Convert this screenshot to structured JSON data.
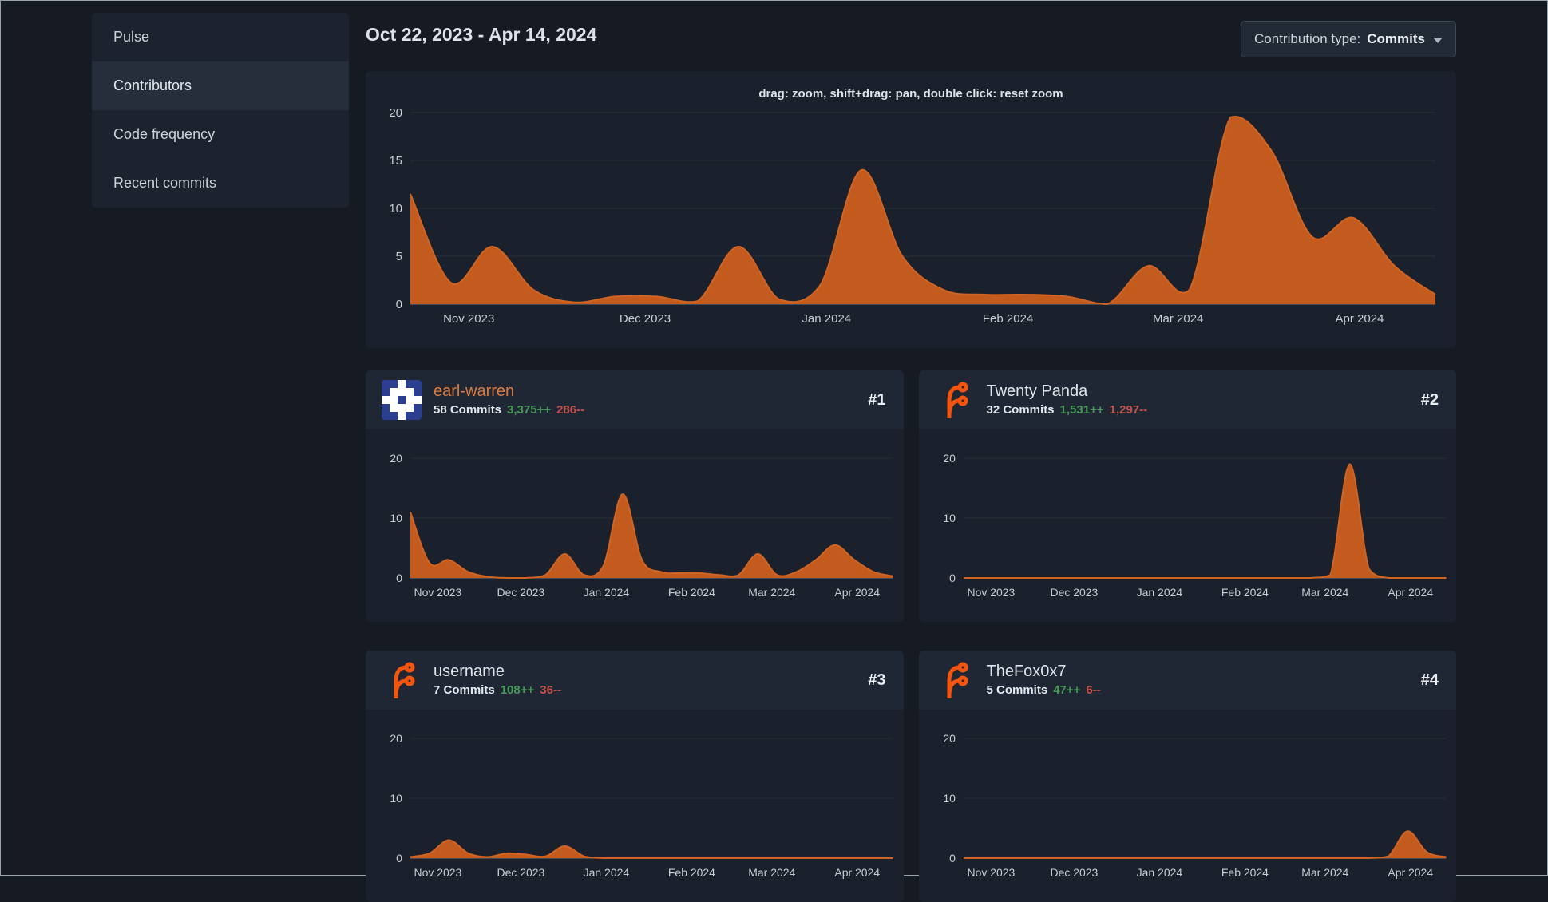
{
  "colors": {
    "page_bg": "#151a23",
    "panel_bg": "#1b212c",
    "card_header_bg": "#202734",
    "sidebar_bg": "#1c232e",
    "sidebar_active_bg": "#262e3b",
    "border_outline": "#9aa2ac",
    "text_primary": "#dde2e9",
    "button_bg": "#222a36",
    "button_border": "#3e4857",
    "button_text": "#ccd3dc",
    "button_text_bold": "#eaeef4",
    "chart_fill": "#c25b1d",
    "chart_stroke": "#cf6425",
    "grid_line": "#272e39",
    "axis_line": "#6a7482",
    "axis_label": "#c6ccd4",
    "green": "#459a56",
    "red": "#c35049",
    "link_orange": "#d87a41",
    "logo_orange": "#f3540e",
    "identicon_blue": "#2c3e8f",
    "identicon_fg": "#ffffff"
  },
  "sidebar": {
    "items": [
      {
        "label": "Pulse"
      },
      {
        "label": "Contributors"
      },
      {
        "label": "Code frequency"
      },
      {
        "label": "Recent commits"
      }
    ],
    "active_item": "Contributors"
  },
  "toolbar": {
    "date_range": "Oct 22, 2023 - Apr 14, 2024",
    "contribution_type_label": "Contribution type:",
    "contribution_type_value": "Commits"
  },
  "contributors": [
    {
      "rank": "#1",
      "name": "earl-warren",
      "commits": "58 Commits",
      "additions": "3,375++",
      "deletions": "286--",
      "avatar": "identicon",
      "name_color": "#d87a41"
    },
    {
      "rank": "#2",
      "name": "Twenty Panda",
      "commits": "32 Commits",
      "additions": "1,531++",
      "deletions": "1,297--",
      "avatar": "forgejo-logo",
      "name_color": "#dfe4ea"
    },
    {
      "rank": "#3",
      "name": "username",
      "commits": "7 Commits",
      "additions": "108++",
      "deletions": "36--",
      "avatar": "forgejo-logo",
      "name_color": "#dfe4ea"
    },
    {
      "rank": "#4",
      "name": "TheFox0x7",
      "commits": "5 Commits",
      "additions": "47++",
      "deletions": "6--",
      "avatar": "forgejo-logo",
      "name_color": "#dfe4ea"
    }
  ],
  "chart_data": [
    {
      "id": "all-contributions",
      "type": "area",
      "title": "drag: zoom, shift+drag: pan, double click: reset zoom",
      "x_range": [
        "Oct 22, 2023",
        "Apr 14, 2024"
      ],
      "x_unit": "week",
      "ylim": [
        0,
        20
      ],
      "yticks": [
        0,
        5,
        10,
        15,
        20
      ],
      "xticks": [
        {
          "label": "Nov 2023",
          "f": 0.057
        },
        {
          "label": "Dec 2023",
          "f": 0.229
        },
        {
          "label": "Jan 2024",
          "f": 0.406
        },
        {
          "label": "Feb 2024",
          "f": 0.583
        },
        {
          "label": "Mar 2024",
          "f": 0.749
        },
        {
          "label": "Apr 2024",
          "f": 0.926
        }
      ],
      "series": [
        {
          "name": "Commits",
          "values": [
            11.5,
            2.2,
            6,
            1.5,
            0.2,
            0.8,
            0.8,
            0.3,
            6,
            0.5,
            2,
            14,
            5,
            1.5,
            1,
            1,
            0.8,
            0,
            4,
            1.5,
            19.5,
            16,
            7,
            9,
            4,
            1
          ]
        }
      ]
    },
    {
      "id": "earl-warren-commits",
      "type": "area",
      "ylim": [
        0,
        20
      ],
      "yticks": [
        0,
        10,
        20
      ],
      "xticks": [
        {
          "label": "Nov 2023",
          "f": 0.057
        },
        {
          "label": "Dec 2023",
          "f": 0.229
        },
        {
          "label": "Jan 2024",
          "f": 0.406
        },
        {
          "label": "Feb 2024",
          "f": 0.583
        },
        {
          "label": "Mar 2024",
          "f": 0.749
        },
        {
          "label": "Apr 2024",
          "f": 0.926
        }
      ],
      "series": [
        {
          "name": "Commits",
          "values": [
            11,
            2.5,
            3,
            1,
            0.2,
            0,
            0,
            0.5,
            4,
            0.5,
            2,
            14,
            3,
            1,
            0.8,
            0.8,
            0.5,
            0.5,
            4,
            0.5,
            1,
            3,
            5.5,
            3,
            1,
            0.3
          ]
        }
      ]
    },
    {
      "id": "twenty-panda-commits",
      "type": "area",
      "ylim": [
        0,
        20
      ],
      "yticks": [
        0,
        10,
        20
      ],
      "xticks": [
        {
          "label": "Nov 2023",
          "f": 0.057
        },
        {
          "label": "Dec 2023",
          "f": 0.229
        },
        {
          "label": "Jan 2024",
          "f": 0.406
        },
        {
          "label": "Feb 2024",
          "f": 0.583
        },
        {
          "label": "Mar 2024",
          "f": 0.749
        },
        {
          "label": "Apr 2024",
          "f": 0.926
        }
      ],
      "series": [
        {
          "name": "Commits",
          "values": [
            0,
            0,
            0,
            0,
            0,
            0,
            0,
            0,
            0,
            0,
            0,
            0,
            0,
            0,
            0,
            0,
            0,
            0,
            0,
            0.5,
            19,
            1.5,
            0,
            0,
            0,
            0
          ]
        }
      ]
    },
    {
      "id": "username-commits",
      "type": "area",
      "ylim": [
        0,
        20
      ],
      "yticks": [
        0,
        10,
        20
      ],
      "xticks": [
        {
          "label": "Nov 2023",
          "f": 0.057
        },
        {
          "label": "Dec 2023",
          "f": 0.229
        },
        {
          "label": "Jan 2024",
          "f": 0.406
        },
        {
          "label": "Feb 2024",
          "f": 0.583
        },
        {
          "label": "Mar 2024",
          "f": 0.749
        },
        {
          "label": "Apr 2024",
          "f": 0.926
        }
      ],
      "series": [
        {
          "name": "Commits",
          "values": [
            0.2,
            0.8,
            3,
            0.8,
            0.2,
            0.8,
            0.6,
            0.3,
            2,
            0.3,
            0,
            0,
            0,
            0,
            0,
            0,
            0,
            0,
            0,
            0,
            0,
            0,
            0,
            0,
            0,
            0
          ]
        }
      ]
    },
    {
      "id": "thefox0x7-commits",
      "type": "area",
      "ylim": [
        0,
        20
      ],
      "yticks": [
        0,
        10,
        20
      ],
      "xticks": [
        {
          "label": "Nov 2023",
          "f": 0.057
        },
        {
          "label": "Dec 2023",
          "f": 0.229
        },
        {
          "label": "Jan 2024",
          "f": 0.406
        },
        {
          "label": "Feb 2024",
          "f": 0.583
        },
        {
          "label": "Mar 2024",
          "f": 0.749
        },
        {
          "label": "Apr 2024",
          "f": 0.926
        }
      ],
      "series": [
        {
          "name": "Commits",
          "values": [
            0,
            0,
            0,
            0,
            0,
            0,
            0,
            0,
            0,
            0,
            0,
            0,
            0,
            0,
            0,
            0,
            0,
            0,
            0,
            0,
            0,
            0,
            0.3,
            4.5,
            1,
            0.2
          ]
        }
      ]
    }
  ]
}
